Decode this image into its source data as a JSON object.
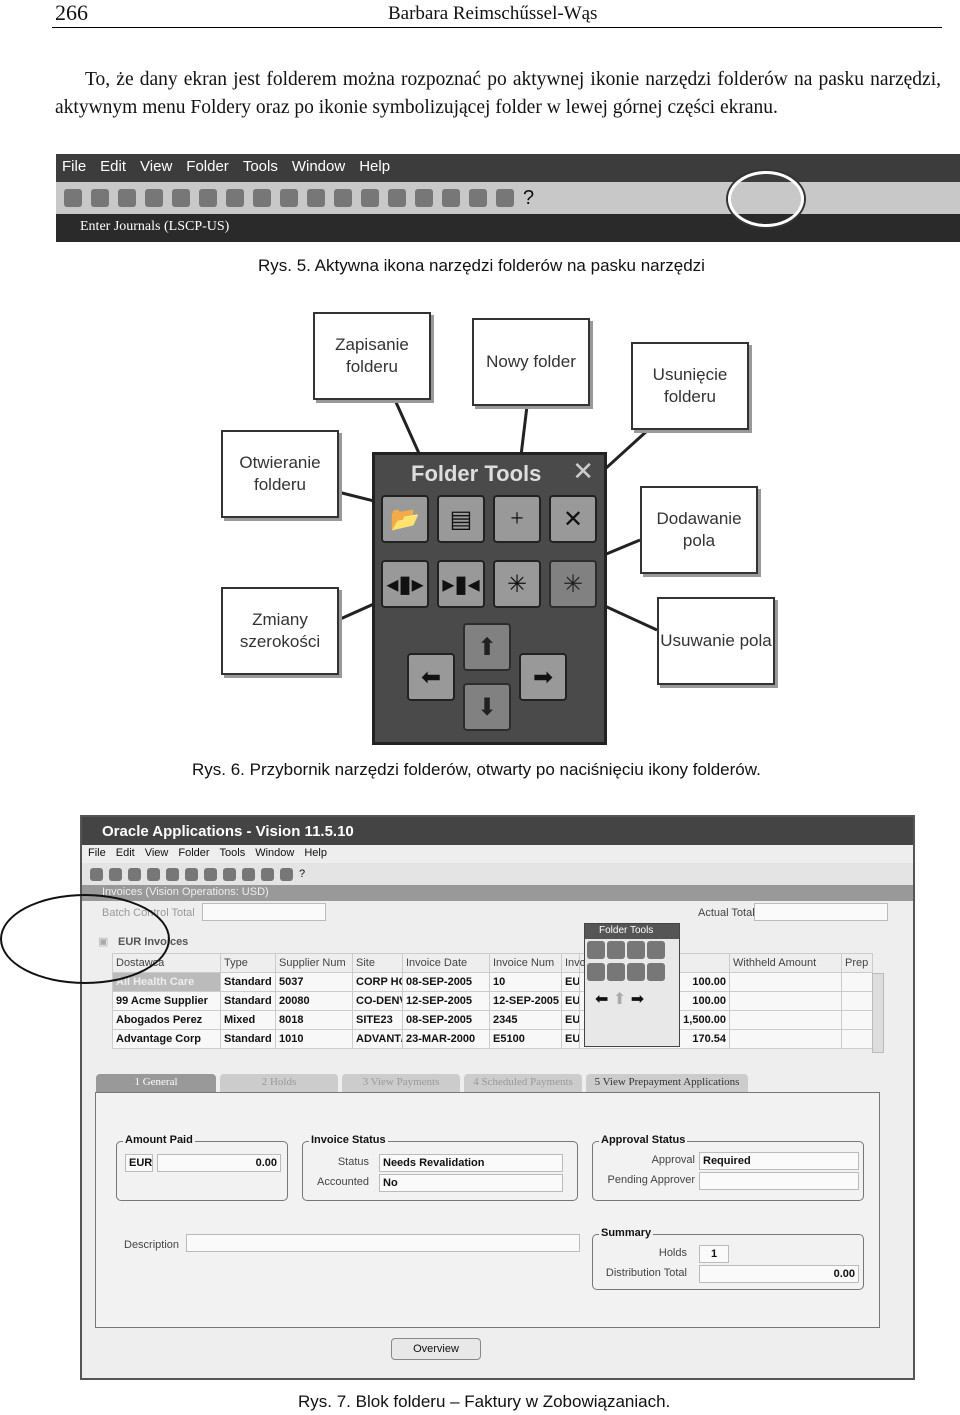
{
  "header": {
    "page_number": "266",
    "author": "Barbara Reimschűssel-Wąs"
  },
  "paragraph": "To, że dany ekran jest folderem można rozpoznać po aktywnej ikonie narzędzi folderów na pasku narzędzi, aktywnym menu Foldery oraz po ikonie symbolizującej folder w lewej górnej części ekranu.",
  "fig5": {
    "menu": [
      "File",
      "Edit",
      "View",
      "Folder",
      "Tools",
      "Window",
      "Help"
    ],
    "window_title": "Enter Journals (LSCP-US)",
    "caption": "Rys. 5. Aktywna ikona narzędzi folderów na pasku narzędzi"
  },
  "fig6": {
    "toolbox_title": "Folder Tools",
    "labels": {
      "save": "Zapisanie folderu",
      "new": "Nowy folder",
      "delete": "Usunięcie folderu",
      "open": "Otwieranie folderu",
      "add_field": "Dodawanie pola",
      "width": "Zmiany szerokości",
      "remove_field": "Usuwanie pola"
    },
    "caption": "Rys. 6. Przybornik narzędzi folderów, otwarty po naciśnięciu ikony folderów."
  },
  "fig7": {
    "app_title": "Oracle Applications - Vision 11.5.10",
    "menu": [
      "File",
      "Edit",
      "View",
      "Folder",
      "Tools",
      "Window",
      "Help"
    ],
    "window_title": "Invoices (Vision Operations: USD)",
    "batch_control_total": "Batch Control Total",
    "actual_total": "Actual Total",
    "folder_name": "EUR Invoices",
    "columns": [
      "Dostawca",
      "Type",
      "Supplier Num",
      "Site",
      "Invoice Date",
      "Invoice Num",
      "Invo",
      "mount",
      "Withheld Amount",
      "Prep"
    ],
    "rows": [
      [
        "All Health Care",
        "Standard",
        "5037",
        "CORP HC",
        "08-SEP-2005",
        "10",
        "EUI",
        "100.00"
      ],
      [
        "99 Acme Supplier",
        "Standard",
        "20080",
        "CO-DENV",
        "12-SEP-2005",
        "12-SEP-2005",
        "EUI",
        "100.00"
      ],
      [
        "Abogados Perez",
        "Mixed",
        "8018",
        "SITE23",
        "08-SEP-2005",
        "2345",
        "EUI",
        "1,500.00"
      ],
      [
        "Advantage Corp",
        "Standard",
        "1010",
        "ADVANT/",
        "23-MAR-2000",
        "E5100",
        "EUI",
        "170.54"
      ]
    ],
    "folder_tools_title": "Folder Tools",
    "tabs": [
      "1 General",
      "2 Holds",
      "3 View Payments",
      "4 Scheduled Payments",
      "5 View Prepayment Applications"
    ],
    "amount_paid": {
      "label": "Amount Paid",
      "currency": "EUR",
      "value": "0.00"
    },
    "invoice_status": {
      "label": "Invoice Status",
      "status_label": "Status",
      "status": "Needs Revalidation",
      "accounted_label": "Accounted",
      "accounted": "No"
    },
    "approval_status": {
      "label": "Approval Status",
      "approval_label": "Approval",
      "approval": "Required",
      "pending_label": "Pending Approver"
    },
    "description_label": "Description",
    "summary": {
      "label": "Summary",
      "holds_label": "Holds",
      "holds": "1",
      "dist_label": "Distribution Total",
      "dist": "0.00"
    },
    "overview_button": "Overview",
    "caption": "Rys. 7. Blok folderu – Faktury w Zobowiązaniach."
  }
}
